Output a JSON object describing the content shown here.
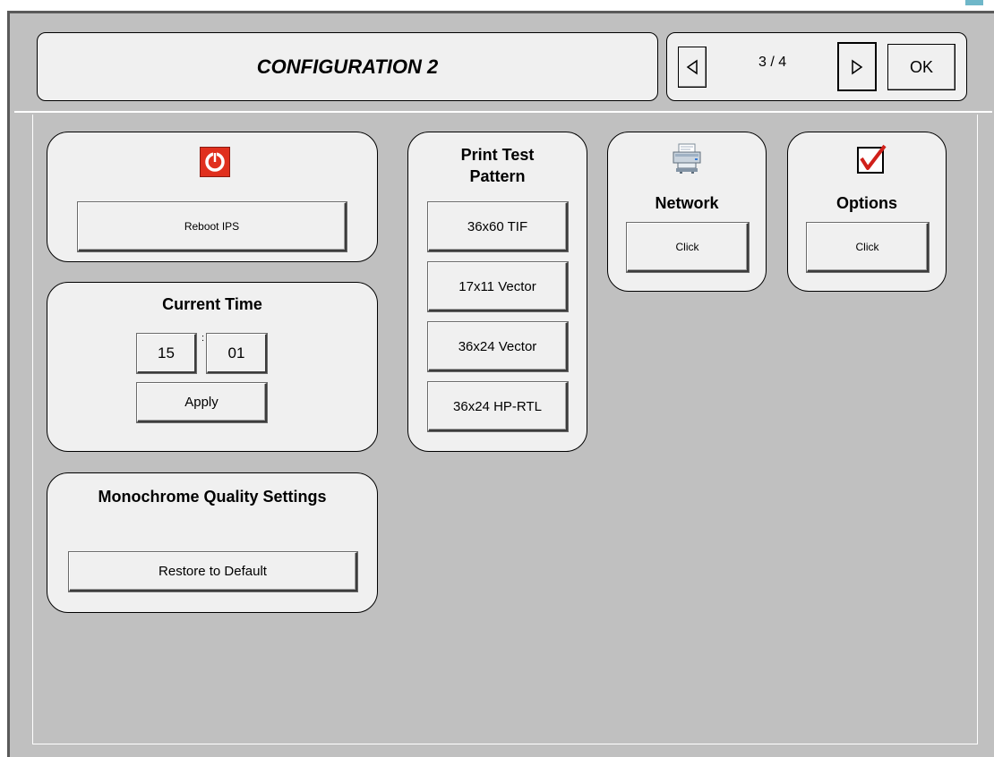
{
  "header": {
    "title": "CONFIGURATION 2",
    "page_indicator": "3 / 4",
    "prev_icon": "triangle-left-icon",
    "next_icon": "triangle-right-icon",
    "ok_label": "OK"
  },
  "reboot_panel": {
    "icon": "power-icon",
    "icon_color": "#e0301e",
    "button_label": "Reboot IPS"
  },
  "time_panel": {
    "title": "Current Time",
    "hour": "15",
    "separator": ":",
    "minute": "01",
    "apply_label": "Apply"
  },
  "quality_panel": {
    "title": "Monochrome Quality Settings",
    "button_label": "Restore to Default"
  },
  "test_pattern_panel": {
    "title_line1": "Print Test",
    "title_line2": "Pattern",
    "buttons": [
      "36x60 TIF",
      "17x11 Vector",
      "36x24 Vector",
      "36x24 HP-RTL"
    ]
  },
  "network_panel": {
    "icon": "printer-icon",
    "title": "Network",
    "button_label": "Click"
  },
  "options_panel": {
    "icon": "checkbox-checked-icon",
    "check_color": "#d0201a",
    "title": "Options",
    "button_label": "Click"
  }
}
